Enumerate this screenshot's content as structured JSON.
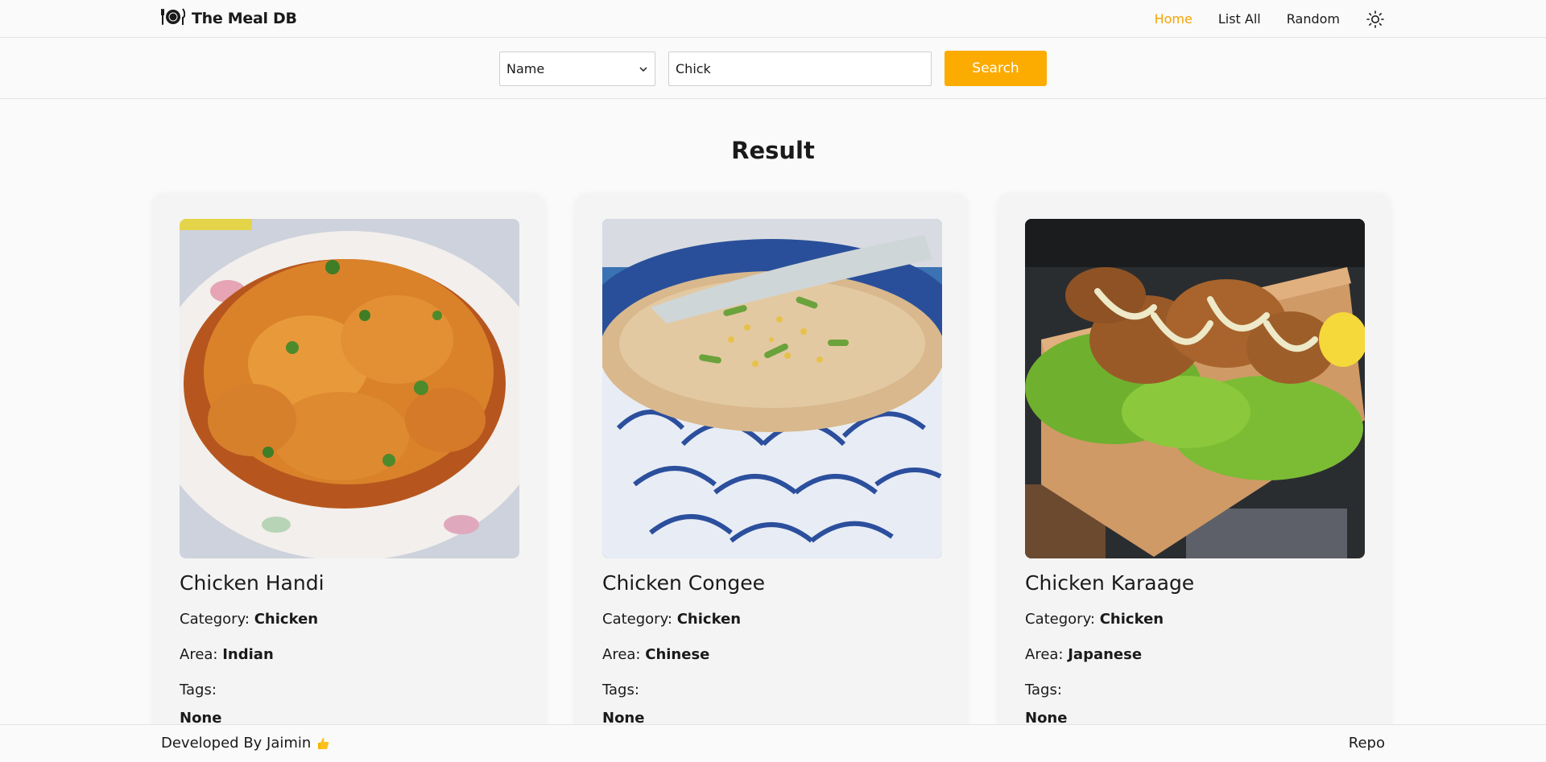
{
  "navbar": {
    "logo_icon": "plate-cutlery-icon",
    "brand": "The Meal DB",
    "links": [
      {
        "label": "Home",
        "active": true
      },
      {
        "label": "List All",
        "active": false
      },
      {
        "label": "Random",
        "active": false
      }
    ],
    "theme_icon": "sun-icon",
    "accent_color": "#f5a400"
  },
  "search": {
    "mode_selected": "Name",
    "query": "Chick",
    "button_label": "Search"
  },
  "result_heading": "Result",
  "labels": {
    "category": "Category:",
    "area": "Area:",
    "tags": "Tags:"
  },
  "meals": [
    {
      "title": "Chicken Handi",
      "category": "Chicken",
      "area": "Indian",
      "tags": "None",
      "image": "chicken-handi-photo"
    },
    {
      "title": "Chicken Congee",
      "category": "Chicken",
      "area": "Chinese",
      "tags": "None",
      "image": "chicken-congee-photo"
    },
    {
      "title": "Chicken Karaage",
      "category": "Chicken",
      "area": "Japanese",
      "tags": "None",
      "image": "chicken-karaage-photo"
    }
  ],
  "footer": {
    "credit": "Developed By Jaimin",
    "credit_icon": "thumbs-up-icon",
    "repo_label": "Repo"
  }
}
